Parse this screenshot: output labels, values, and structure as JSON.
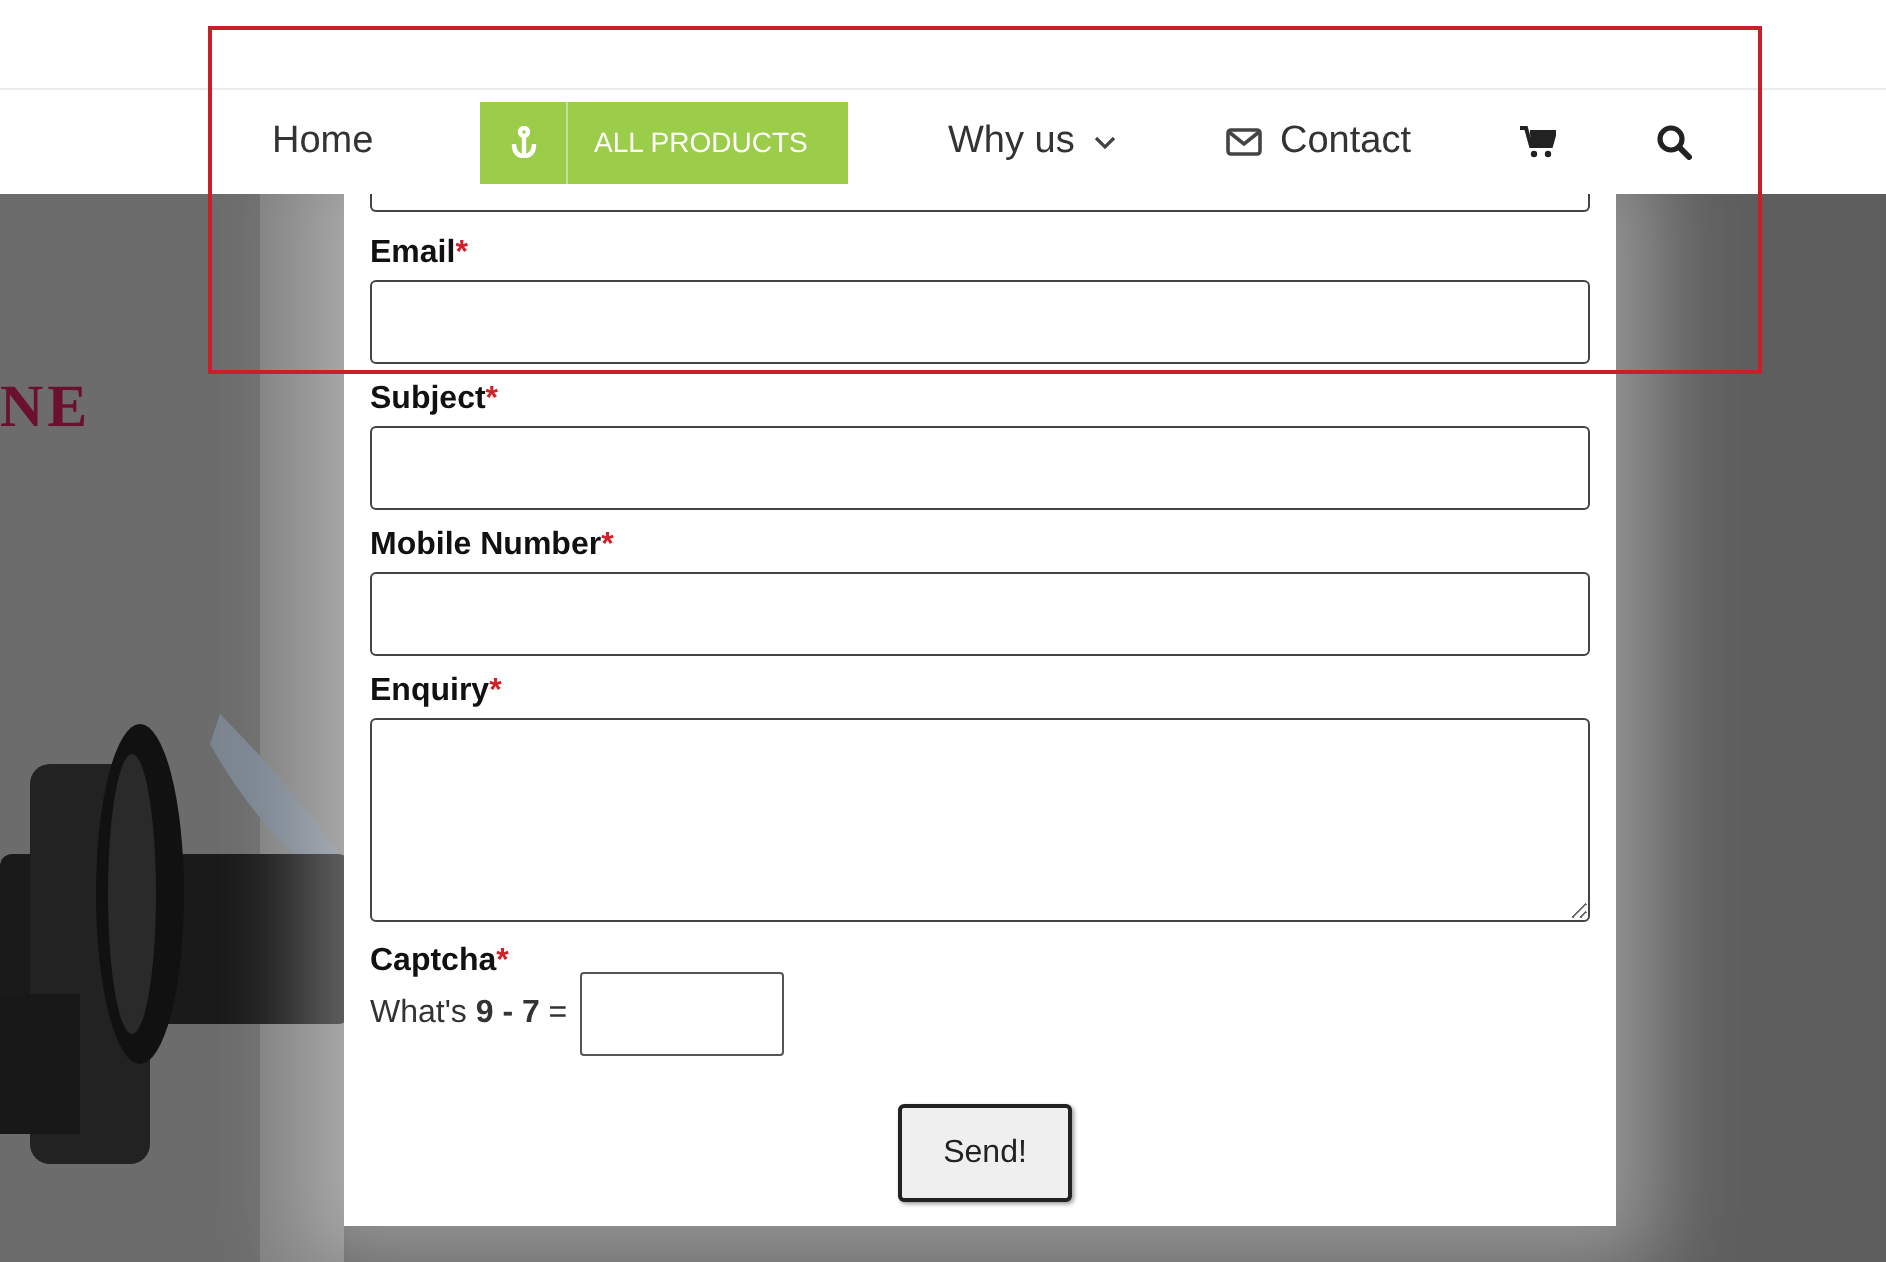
{
  "nav": {
    "items": [
      {
        "kind": "link",
        "label": "Home"
      },
      {
        "kind": "featured",
        "label": "ALL PRODUCTS"
      },
      {
        "kind": "dropdown",
        "label": "Why us"
      },
      {
        "kind": "mail",
        "label": "Contact"
      },
      {
        "kind": "cart"
      },
      {
        "kind": "search"
      }
    ]
  },
  "banner": {
    "heading": "NE"
  },
  "form": {
    "fields": [
      {
        "kind": "clipped"
      },
      {
        "kind": "input",
        "label": "Email",
        "marker": "*"
      },
      {
        "kind": "input",
        "label": "Subject",
        "marker": "*"
      },
      {
        "kind": "input",
        "label": "Mobile Number",
        "marker": "*"
      },
      {
        "kind": "textarea",
        "label": "Enquiry",
        "marker": "*"
      }
    ],
    "captcha": {
      "label": "Captcha",
      "marker": "*",
      "question": "What's **9 - 7** ="
    },
    "submit": "Send!"
  }
}
